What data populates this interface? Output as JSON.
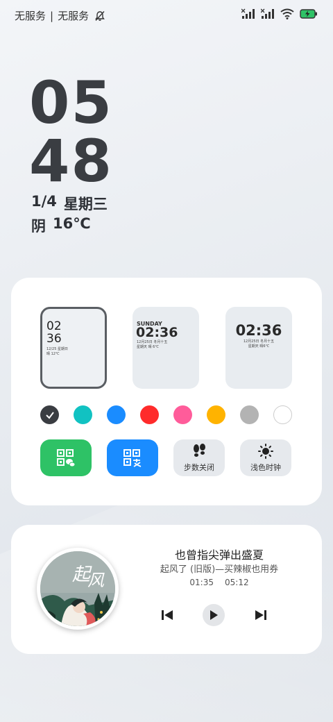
{
  "status": {
    "carrier_1": "无服务",
    "separator": "|",
    "carrier_2": "无服务"
  },
  "clock": {
    "hour": "05",
    "minute": "48",
    "date": "1/4",
    "weekday": "星期三",
    "weather": "阴",
    "temperature": "16℃"
  },
  "styles": {
    "style1": {
      "hour": "02",
      "minute": "36",
      "date": "12/25 星期日",
      "weather": "晴 12℃"
    },
    "style2": {
      "day": "SUNDAY",
      "time": "02:36",
      "line1": "12月25日 冬月十五",
      "line2": "星期天 晴 6℃"
    },
    "style3": {
      "time": "02:36",
      "line1": "12月25日 冬月十五",
      "line2": "星期天 晴6℃"
    }
  },
  "colors": {
    "swatches": [
      "#3a3d42",
      "#11c2c2",
      "#1a8cff",
      "#ff2b2b",
      "#ff5c9a",
      "#ffb300",
      "#b3b3b3",
      "#ffffff"
    ],
    "selected": "#3a3d42"
  },
  "actions": {
    "wechat_pay_color": "#2ec266",
    "alipay_color": "#1a8cff",
    "steps_label": "步数关闭",
    "light_clock_label": "浅色时钟"
  },
  "music": {
    "title": "也曾指尖弹出盛夏",
    "artist": "起风了 (旧版)—买辣椒也用券",
    "current_time": "01:35",
    "total_time": "05:12"
  }
}
